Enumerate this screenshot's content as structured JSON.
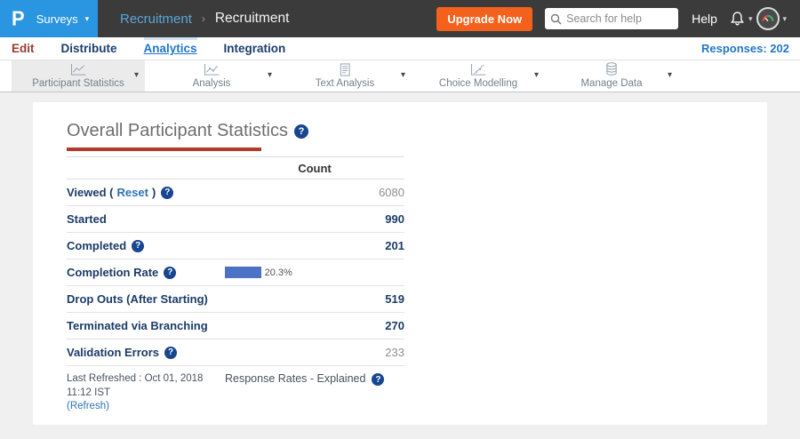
{
  "topbar": {
    "logo_text": "P",
    "product_menu": "Surveys",
    "breadcrumb": {
      "parent": "Recruitment",
      "separator": "›",
      "current": "Recruitment"
    },
    "upgrade_label": "Upgrade Now",
    "search_placeholder": "Search for help",
    "help_label": "Help"
  },
  "nav": {
    "edit": "Edit",
    "distribute": "Distribute",
    "analytics": "Analytics",
    "integration": "Integration",
    "responses": "Responses: 202"
  },
  "toolbar": {
    "items": [
      {
        "label": "Participant Statistics",
        "icon": "line-chart-icon",
        "selected": true
      },
      {
        "label": "Analysis",
        "icon": "analysis-chart-icon",
        "selected": false
      },
      {
        "label": "Text Analysis",
        "icon": "document-icon",
        "selected": false
      },
      {
        "label": "Choice Modelling",
        "icon": "step-chart-icon",
        "selected": false
      },
      {
        "label": "Manage Data",
        "icon": "database-icon",
        "selected": false
      }
    ]
  },
  "main": {
    "title": "Overall Participant Statistics",
    "table": {
      "count_header": "Count",
      "rows": [
        {
          "label": "Viewed (",
          "link": "Reset",
          "label_suffix": ")",
          "help": true,
          "value": "6080",
          "value_style": "muted"
        },
        {
          "label": "Started",
          "help": false,
          "value": "990",
          "value_style": "strong"
        },
        {
          "label": "Completed",
          "help": true,
          "value": "201",
          "value_style": "strong"
        },
        {
          "label": "Completion Rate",
          "help": true,
          "bar_percent": 20.3,
          "bar_label": "20.3%"
        },
        {
          "label": "Drop Outs (After Starting)",
          "help": false,
          "value": "519",
          "value_style": "strong"
        },
        {
          "label": "Terminated via Branching",
          "help": false,
          "value": "270",
          "value_style": "strong"
        },
        {
          "label": "Validation Errors",
          "help": true,
          "value": "233",
          "value_style": "muted"
        }
      ]
    },
    "footer": {
      "last_refreshed": "Last Refreshed : Oct 01, 2018 11:12 IST",
      "refresh_link": "(Refresh)",
      "response_rates": "Response Rates - Explained"
    }
  },
  "colors": {
    "topbar_bg": "#3b3b3b",
    "logo_bg": "#2a95e0",
    "upgrade_orange": "#f4611c",
    "active_link_blue": "#2277c9",
    "label_navy": "#1c3c68",
    "link_blue": "#2e74b5",
    "help_icon_navy": "#17458f",
    "red_underline": "#b5392a",
    "rate_bar_blue": "#4b72c4",
    "edit_red": "#9a3c31"
  }
}
